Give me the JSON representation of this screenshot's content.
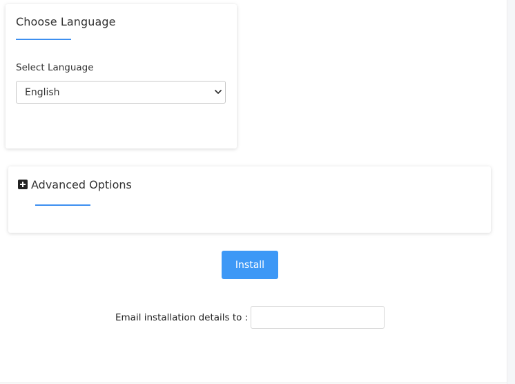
{
  "language_card": {
    "title": "Choose Language",
    "select_label": "Select Language",
    "selected_language": "English"
  },
  "advanced_card": {
    "title": "Advanced Options",
    "expand_icon": "plus-square-icon"
  },
  "install": {
    "button_label": "Install"
  },
  "email": {
    "label": "Email installation details to :",
    "value": "",
    "placeholder": ""
  },
  "colors": {
    "accent": "#3d8ff0",
    "button": "#3d98f6"
  }
}
